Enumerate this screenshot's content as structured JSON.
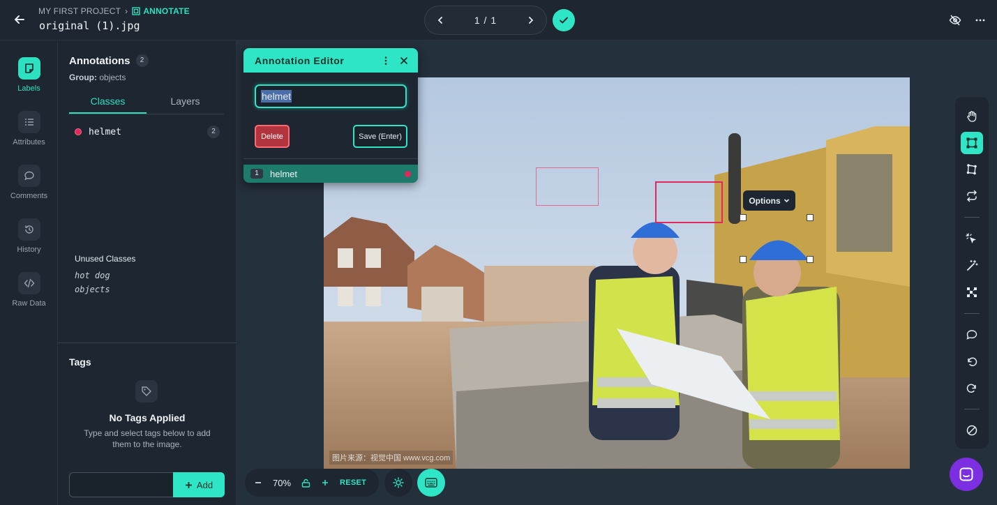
{
  "header": {
    "project": "MY FIRST PROJECT",
    "mode": "ANNOTATE",
    "filename": "original (1).jpg",
    "pager": "1 / 1"
  },
  "rail": {
    "items": [
      {
        "label": "Labels",
        "icon": "tag-icon",
        "active": true
      },
      {
        "label": "Attributes",
        "icon": "list-icon"
      },
      {
        "label": "Comments",
        "icon": "comment-icon"
      },
      {
        "label": "History",
        "icon": "history-icon"
      },
      {
        "label": "Raw Data",
        "icon": "code-icon"
      }
    ]
  },
  "panel": {
    "title": "Annotations",
    "count": "2",
    "group_label": "Group:",
    "group_value": "objects",
    "tabs": [
      "Classes",
      "Layers"
    ],
    "classes": [
      {
        "name": "helmet",
        "count": "2",
        "color": "#e0285a"
      }
    ],
    "unused_title": "Unused Classes",
    "unused": [
      "hot dog",
      "objects"
    ],
    "tags": {
      "title": "Tags",
      "empty_title": "No Tags Applied",
      "empty_desc": "Type and select tags below to add them to the image.",
      "input_value": "",
      "add_label": "Add"
    }
  },
  "editor": {
    "title": "Annotation Editor",
    "input_value": "helmet",
    "delete_label": "Delete",
    "save_label": "Save (Enter)",
    "row_index": "1",
    "row_label": "helmet"
  },
  "canvas": {
    "options_label": "Options",
    "watermark": "图片来源：视觉中国 www.vcg.com"
  },
  "zoom": {
    "value": "70%",
    "reset_label": "RESET"
  },
  "colors": {
    "accent": "#2ee6c5",
    "helmet_class": "#e0285a",
    "background": "#1a222c"
  }
}
